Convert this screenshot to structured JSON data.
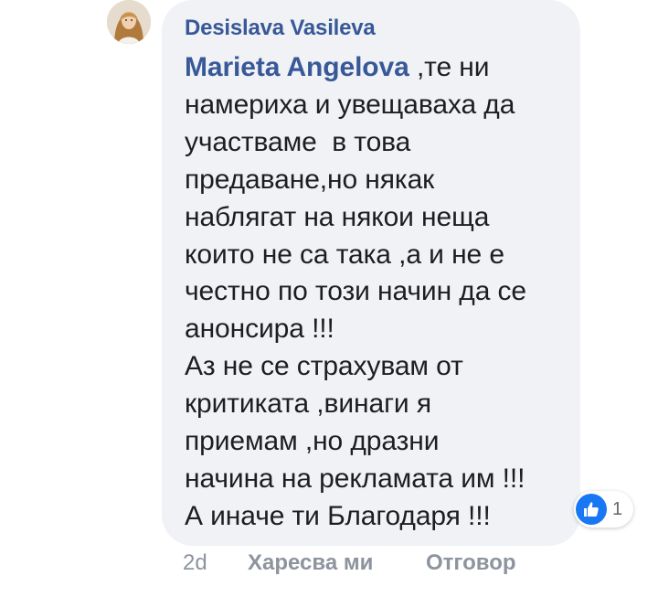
{
  "comment": {
    "author": "Desislava Vasileva",
    "mention": "Marieta Angelova",
    "lines": [
      " ,те ни",
      "намериха и увещаваха да",
      "участваме  в това",
      "предаване,но някак",
      "наблягат на някои неща",
      "които не са така ,а и не е",
      "честно по този начин да се",
      "анонсира !!!",
      "Аз не се страхувам от",
      "критиката ,винаги я",
      "приемам ,но дразни",
      "начина на рекламата им !!!",
      "А иначе ти Благодаря !!!"
    ],
    "reaction_count": "1",
    "reaction_icon": "like-icon",
    "timestamp": "2d",
    "like_label": "Харесва ми",
    "reply_label": "Отговор"
  },
  "colors": {
    "bubble": "#f0f2f5",
    "name": "#385898",
    "text": "#1c1e21",
    "meta": "#8d949e",
    "like_blue": "#1877f2"
  }
}
